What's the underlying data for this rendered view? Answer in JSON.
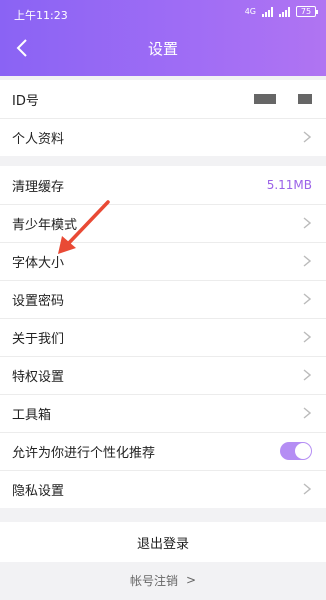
{
  "status_bar": {
    "time": "上午11:23",
    "network": "4G",
    "battery": "75"
  },
  "nav": {
    "title": "设置"
  },
  "section1": [
    {
      "label": "ID号",
      "value": ""
    },
    {
      "label": "个人资料"
    }
  ],
  "section2": [
    {
      "label": "清理缓存",
      "value": "5.11MB"
    },
    {
      "label": "青少年模式"
    },
    {
      "label": "字体大小"
    },
    {
      "label": "设置密码"
    },
    {
      "label": "关于我们"
    },
    {
      "label": "特权设置"
    },
    {
      "label": "工具箱"
    },
    {
      "label": "允许为你进行个性化推荐"
    },
    {
      "label": "隐私设置"
    }
  ],
  "toggle_personalized": {
    "on": true
  },
  "logout": {
    "label": "退出登录"
  },
  "cancel_account": {
    "label": "帐号注销",
    "chevron": ">"
  },
  "colors": {
    "accent": "#9b62e8",
    "header_start": "#8a63f4",
    "header_end": "#b074f2",
    "annotation": "#e94a35"
  }
}
